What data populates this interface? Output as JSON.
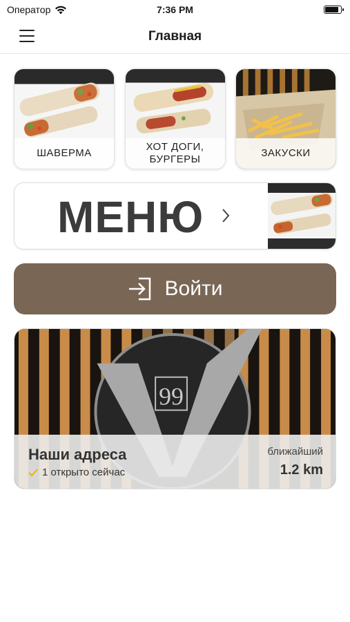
{
  "status": {
    "carrier": "Оператор",
    "time": "7:36 PM",
    "battery_level": 0.9,
    "icons": [
      "wifi-icon",
      "battery-icon"
    ]
  },
  "nav": {
    "title": "Главная",
    "menu_icon": "hamburger-menu-icon"
  },
  "categories": [
    {
      "label": "ШАВЕРМА",
      "image": "shawarma-rolls"
    },
    {
      "label": "ХОТ ДОГИ, БУРГЕРЫ",
      "image": "hotdog-wraps"
    },
    {
      "label": "ЗАКУСКИ",
      "image": "french-fries"
    }
  ],
  "menu_banner": {
    "label": "МЕНЮ",
    "icon": "chevron-right-icon",
    "image": "shawarma-plate"
  },
  "login": {
    "label": "Войти",
    "icon": "login-arrow-icon"
  },
  "addresses": {
    "title": "Наши адреса",
    "open_status": "1 открыто сейчас",
    "nearest_label": "ближайший",
    "distance": "1.2 km",
    "image": "v99-logo-wall",
    "accent_color": "#f0b400"
  },
  "colors": {
    "primary_button": "#7a6655",
    "check_accent": "#f0b400"
  }
}
